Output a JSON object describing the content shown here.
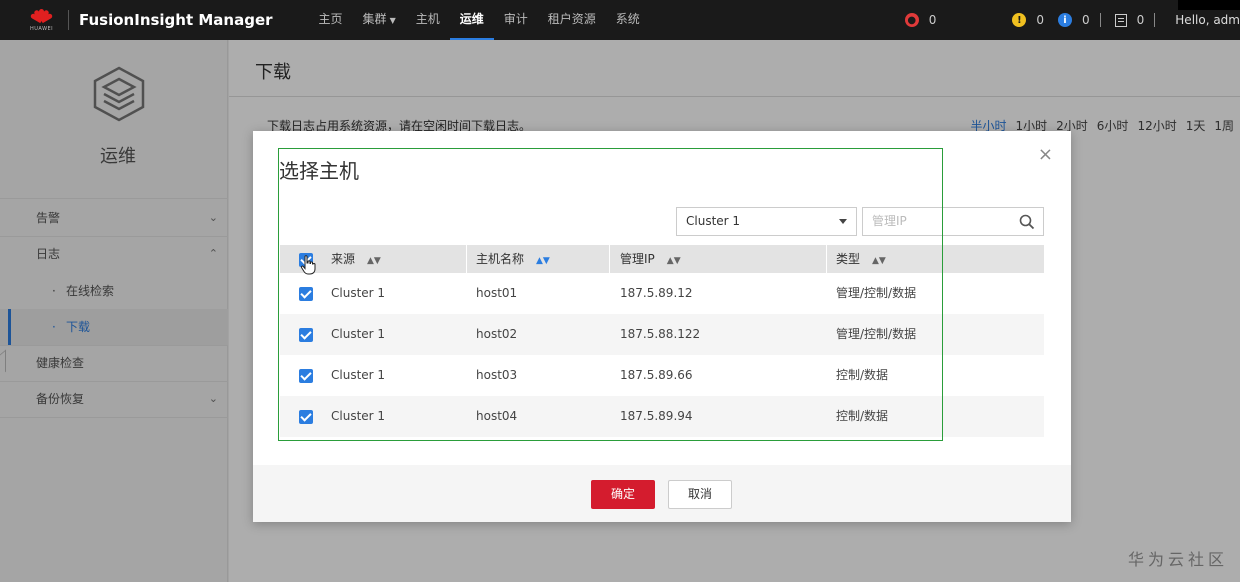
{
  "topbar": {
    "brand_sub": "HUAWEI",
    "app_title": "FusionInsight Manager",
    "nav": [
      {
        "label": "主页"
      },
      {
        "label": "集群"
      },
      {
        "label": "主机"
      },
      {
        "label": "运维"
      },
      {
        "label": "审计"
      },
      {
        "label": "租户资源"
      },
      {
        "label": "系统"
      }
    ],
    "active_nav": "运维",
    "indicators": {
      "critical": "0",
      "major": "0",
      "info": "0",
      "tasks": "0"
    },
    "greeting": "Hello, adm"
  },
  "sidebar": {
    "title": "运维",
    "items": [
      {
        "label": "告警"
      },
      {
        "label": "日志"
      },
      {
        "label": "在线检索"
      },
      {
        "label": "下载"
      },
      {
        "label": "健康检查"
      },
      {
        "label": "备份恢复"
      }
    ]
  },
  "main": {
    "title": "下载",
    "notice": "下载日志占用系统资源，请在空闲时间下载日志。",
    "time_ranges": [
      "半小时",
      "1小时",
      "2小时",
      "6小时",
      "12小时",
      "1天",
      "1周"
    ],
    "selected_range": "半小时"
  },
  "dialog": {
    "title": "选择主机",
    "cluster_select": "Cluster 1",
    "ip_placeholder": "管理IP",
    "columns": [
      "来源",
      "主机名称",
      "管理IP",
      "类型"
    ],
    "rows": [
      {
        "source": "Cluster 1",
        "host": "host01",
        "ip": "187.5.89.12",
        "type": "管理/控制/数据",
        "checked": true
      },
      {
        "source": "Cluster 1",
        "host": "host02",
        "ip": "187.5.88.122",
        "type": "管理/控制/数据",
        "checked": true
      },
      {
        "source": "Cluster 1",
        "host": "host03",
        "ip": "187.5.89.66",
        "type": "控制/数据",
        "checked": true
      },
      {
        "source": "Cluster 1",
        "host": "host04",
        "ip": "187.5.89.94",
        "type": "控制/数据",
        "checked": true
      }
    ],
    "ok_label": "确定",
    "cancel_label": "取消"
  },
  "watermark": "华为云社区",
  "colors": {
    "accent": "#2b7de0",
    "primary_button": "#d41c2e",
    "highlight_box": "#2a9d3a"
  }
}
